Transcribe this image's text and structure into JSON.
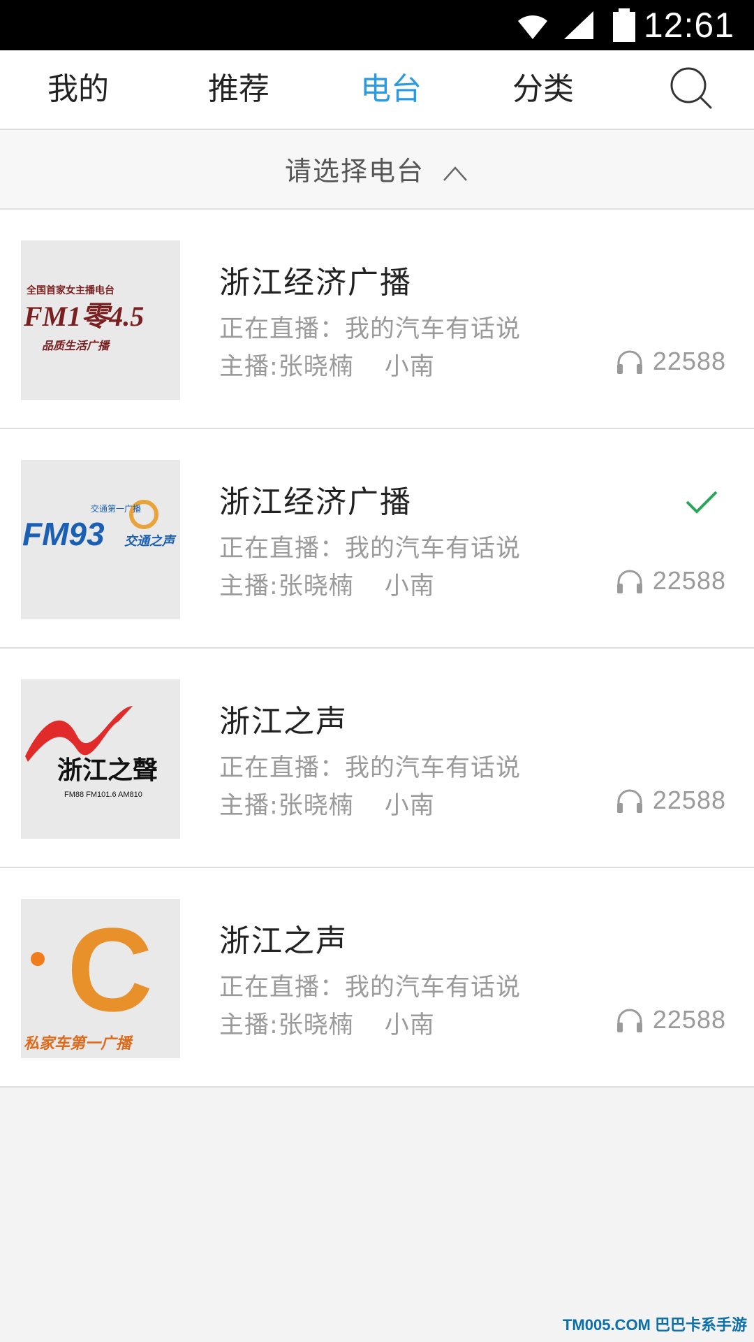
{
  "status_bar": {
    "time": "12:61",
    "icons": [
      "wifi-icon",
      "signal-icon",
      "battery-icon"
    ]
  },
  "tabs": [
    {
      "label": "我的",
      "active": false
    },
    {
      "label": "推荐",
      "active": false
    },
    {
      "label": "电台",
      "active": true
    },
    {
      "label": "分类",
      "active": false
    }
  ],
  "search": {
    "icon": "search-icon"
  },
  "selector": {
    "label": "请选择电台",
    "icon": "chevron-up-icon"
  },
  "stations": [
    {
      "logo_text_top": "全国首家女主播电台",
      "logo_text_main": "FM1零4.5",
      "logo_text_sub": "品质生活广播",
      "title": "浙江经济广播",
      "live": "正在直播：我的汽车有话说",
      "host_label": "主播:张晓楠",
      "host2": "小南",
      "listeners": "22588",
      "selected": false
    },
    {
      "logo_text_top": "交通第一广播",
      "logo_text_main": "FM93",
      "logo_text_sub": "交通之声",
      "title": "浙江经济广播",
      "live": "正在直播：我的汽车有话说",
      "host_label": "主播:张晓楠",
      "host2": "小南",
      "listeners": "22588",
      "selected": true
    },
    {
      "logo_text_top": "",
      "logo_text_main": "浙江之聲",
      "logo_text_sub": "FM88 FM101.6 AM810",
      "title": "浙江之声",
      "live": "正在直播：我的汽车有话说",
      "host_label": "主播:张晓楠",
      "host2": "小南",
      "listeners": "22588",
      "selected": false
    },
    {
      "logo_text_top": "",
      "logo_text_main": "C",
      "logo_text_sub": "私家车第一广播",
      "title": "浙江之声",
      "live": "正在直播：我的汽车有话说",
      "host_label": "主播:张晓楠",
      "host2": "小南",
      "listeners": "22588",
      "selected": false
    }
  ],
  "colors": {
    "accent": "#2a9be3",
    "check": "#2aa55a",
    "logo_red": "#7a1f1f",
    "logo_blue": "#1a5fb4",
    "logo_orange": "#e8912a"
  },
  "watermark": {
    "text": "TM005.COM 巴巴卡系手游"
  }
}
